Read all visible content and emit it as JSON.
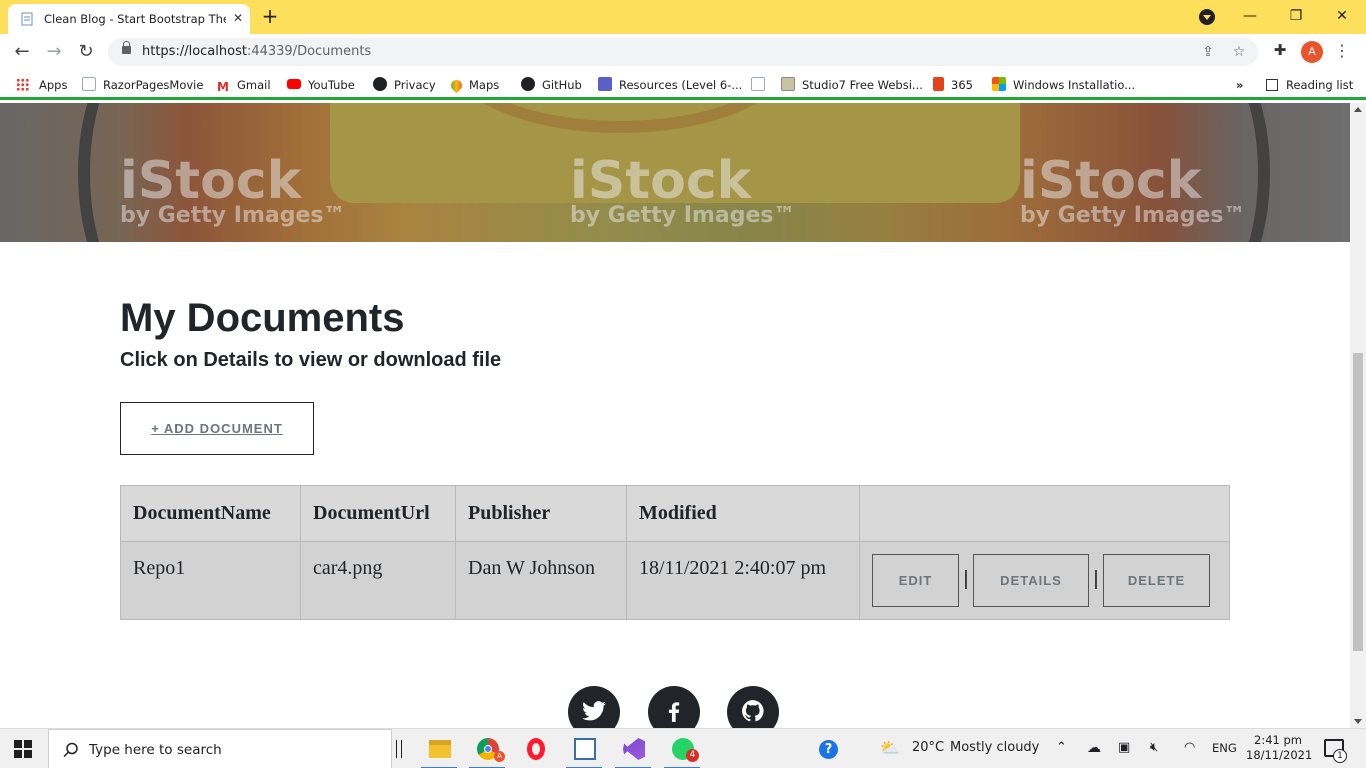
{
  "browser": {
    "tab_title": "Clean Blog - Start Bootstrap Theme",
    "url_host": "https://localhost",
    "url_rest": ":44339/Documents",
    "profile_initial": "A"
  },
  "bookmarks": {
    "items": [
      {
        "label": "Apps"
      },
      {
        "label": "RazorPagesMovie"
      },
      {
        "label": "Gmail"
      },
      {
        "label": "YouTube"
      },
      {
        "label": "Privacy"
      },
      {
        "label": "Maps"
      },
      {
        "label": "GitHub"
      },
      {
        "label": "Resources (Level 6-..."
      },
      {
        "label": ""
      },
      {
        "label": "Studio7 Free Websi..."
      },
      {
        "label": "365"
      },
      {
        "label": "Windows Installatio..."
      }
    ],
    "overflow": "»",
    "reading_list": "Reading list"
  },
  "hero": {
    "watermark_brand": "iStock",
    "watermark_sub": "by Getty Images™"
  },
  "page": {
    "title": "My Documents",
    "subtitle": "Click on Details to view or download file",
    "add_button": "+ ADD DOCUMENT"
  },
  "table": {
    "headers": [
      "DocumentName",
      "DocumentUrl",
      "Publisher",
      "Modified",
      ""
    ],
    "rows": [
      {
        "name": "Repo1",
        "url": "car4.png",
        "publisher": "Dan W Johnson",
        "modified": "18/11/2021 2:40:07 pm",
        "actions": {
          "edit": "EDIT",
          "details": "DETAILS",
          "delete": "DELETE",
          "sep": "|"
        }
      }
    ]
  },
  "taskbar": {
    "search_placeholder": "Type here to search",
    "weather_temp": "20°C",
    "weather_text": "Mostly cloudy",
    "language": "ENG",
    "time": "2:41 pm",
    "date": "18/11/2021",
    "whatsapp_badge": "4",
    "notifications_count": "1"
  }
}
